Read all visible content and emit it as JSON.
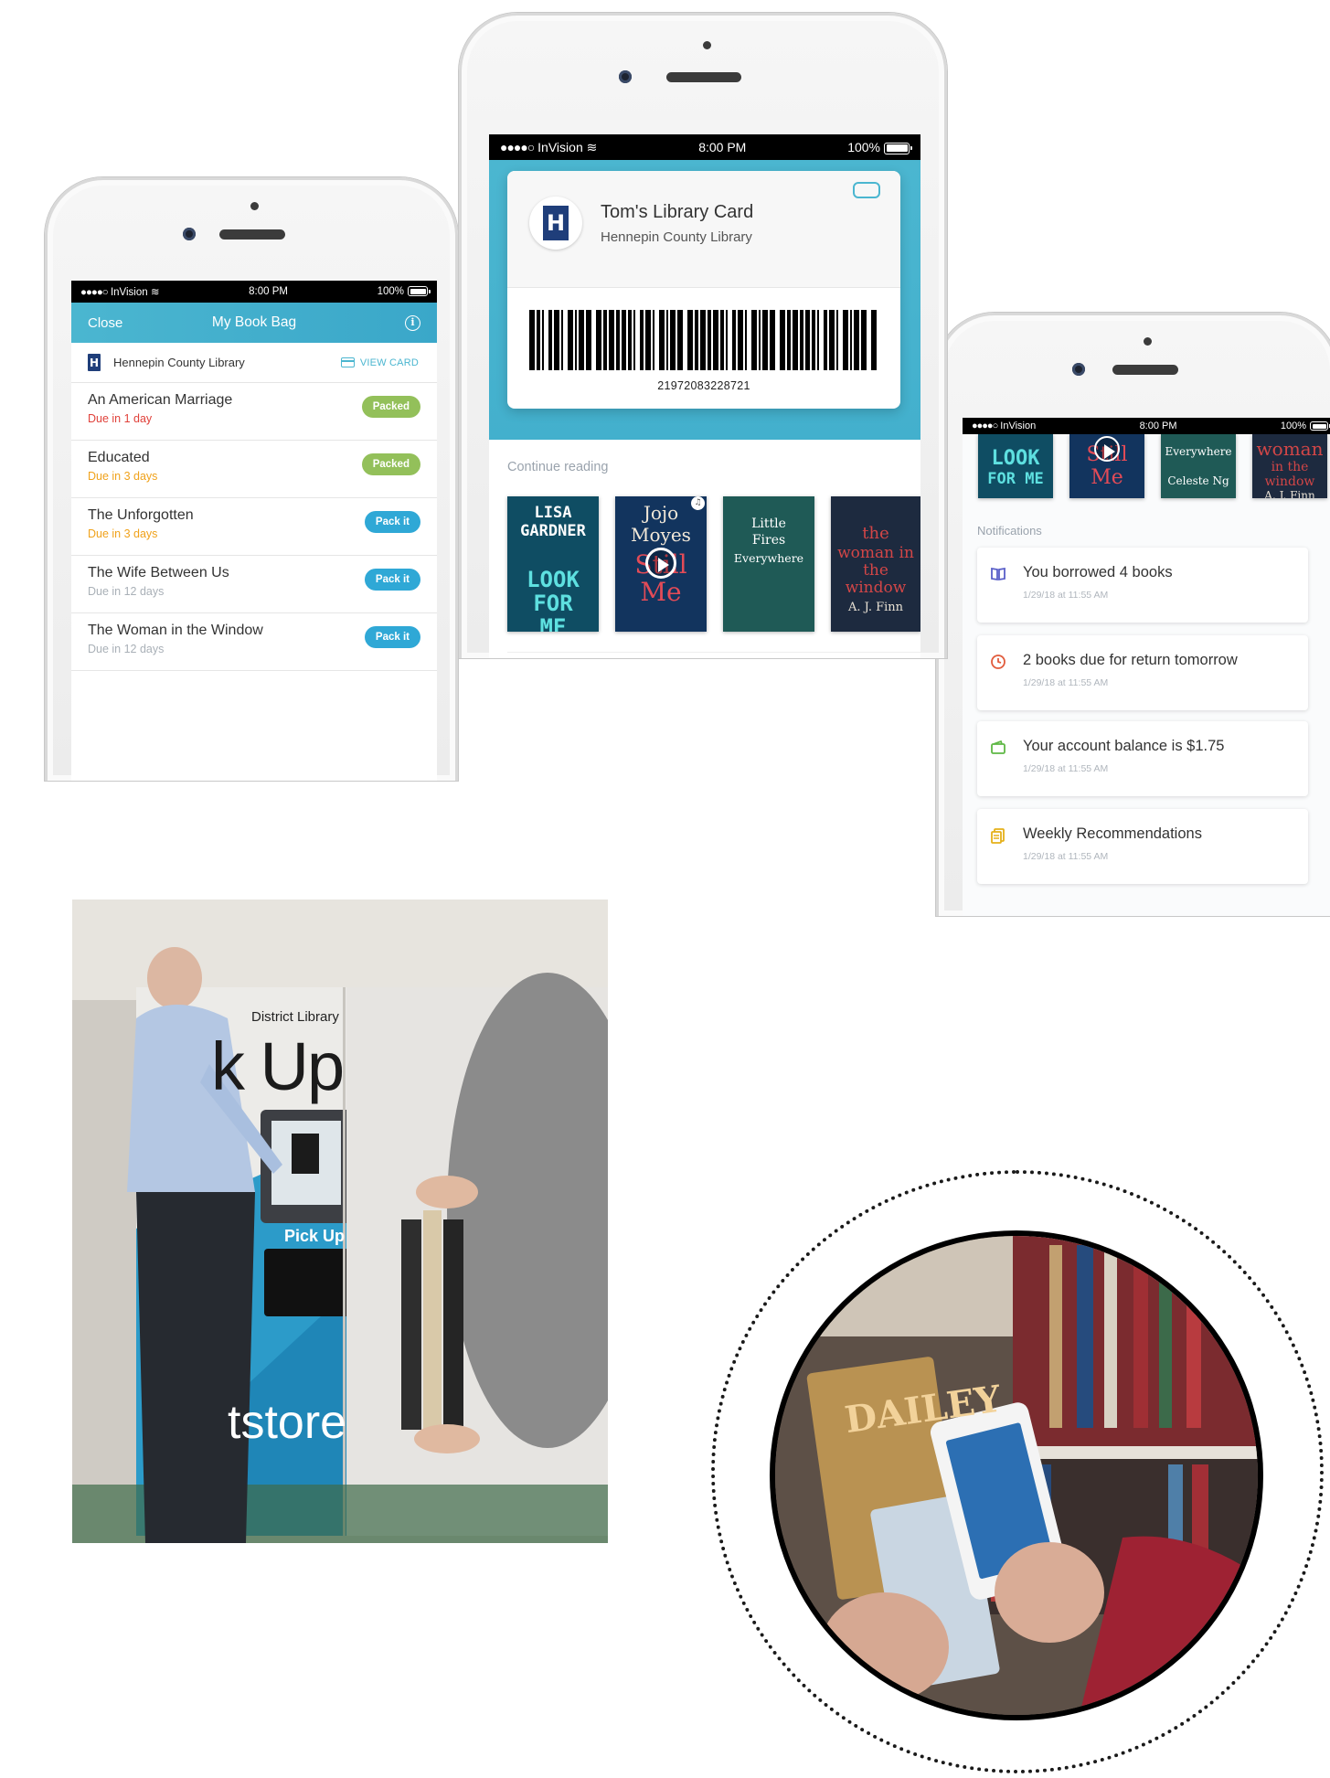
{
  "status_bar": {
    "carrier": "InVision",
    "time": "8:00 PM",
    "battery": "100%"
  },
  "book_bag": {
    "close_label": "Close",
    "title": "My Book Bag",
    "library_name": "Hennepin County Library",
    "view_card_label": "VIEW CARD",
    "items": [
      {
        "title": "An American Marriage",
        "due": "Due in 1 day",
        "action": "Packed"
      },
      {
        "title": "Educated",
        "due": "Due in 3 days",
        "action": "Packed"
      },
      {
        "title": "The Unforgotten",
        "due": "Due in 3 days",
        "action": "Pack it"
      },
      {
        "title": "The Wife Between Us",
        "due": "Due in 12 days",
        "action": "Pack it"
      },
      {
        "title": "The Woman in the Window",
        "due": "Due in 12 days",
        "action": "Pack it"
      }
    ]
  },
  "library_card": {
    "card_title": "Tom's Library Card",
    "library_name": "Hennepin County Library",
    "barcode_number": "21972083228721",
    "continue_reading_label": "Continue reading",
    "books": [
      {
        "title_lines": [
          "LISA",
          "GARDNER",
          "LOOK FOR ME"
        ],
        "color": "#0f4d63"
      },
      {
        "title_lines": [
          "Jojo",
          "Moyes",
          "Still Me"
        ],
        "color": "#12345e",
        "audio": true
      },
      {
        "title_lines": [
          "Little",
          "Fires",
          "Everywhere"
        ],
        "color": "#1f5a56"
      },
      {
        "title_lines": [
          "the",
          "woman in the window",
          "A. J. Finn"
        ],
        "color": "#1d2a3f"
      }
    ]
  },
  "notifications": {
    "section_label": "Notifications",
    "books_strip": [
      {
        "title_lines": [
          "LOOK",
          "FOR ME"
        ],
        "color": "#0f4d63"
      },
      {
        "title_lines": [
          "Still",
          "Me"
        ],
        "color": "#12345e"
      },
      {
        "title_lines": [
          "Everywhere",
          "Celeste Ng"
        ],
        "color": "#1f5a56"
      },
      {
        "title_lines": [
          "woman",
          "in the window",
          "A. J. Finn"
        ],
        "color": "#1d2a3f"
      }
    ],
    "items": [
      {
        "icon": "book-icon",
        "text": "You borrowed 4 books",
        "timestamp": "1/29/18 at 11:55 AM",
        "color": "#5a5fc8"
      },
      {
        "icon": "clock-icon",
        "text": "2 books due for return tomorrow",
        "timestamp": "1/29/18 at 11:55 AM",
        "color": "#e15b3c"
      },
      {
        "icon": "wallet-icon",
        "text": "Your account balance is $1.75",
        "timestamp": "1/29/18 at 11:55 AM",
        "color": "#5fb845"
      },
      {
        "icon": "stack-icon",
        "text": "Weekly Recommendations",
        "timestamp": "1/29/18 at 11:55 AM",
        "color": "#e5b019"
      }
    ]
  },
  "kiosk_photo": {
    "sign_text": "District Library",
    "big_text": "k Up",
    "screen_label": "Pick Up",
    "store_text": "tstore"
  },
  "colors": {
    "brand_teal": "#4bb6d0",
    "packed_green": "#93c05a",
    "pack_it_blue": "#2fa8d6",
    "due_red": "#e0413a",
    "due_orange": "#f0a21b",
    "due_gray": "#a9b0b7"
  }
}
